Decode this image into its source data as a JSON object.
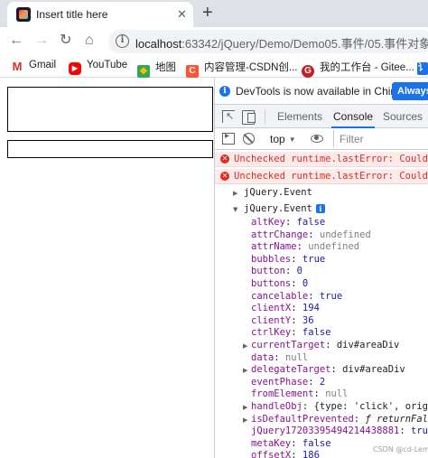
{
  "browser": {
    "tab_title": "Insert title here",
    "tab_close": "✕",
    "new_tab": "+",
    "nav": {
      "back": "←",
      "forward": "→",
      "reload": "↻",
      "home": "⌂"
    },
    "url_host": "localhost",
    "url_rest": ":63342/jQuery/Demo/Demo05.事件/05.事件对象",
    "info_glyph": "i"
  },
  "bookmarks": [
    {
      "label": "Gmail",
      "icon": "gmail-icon",
      "glyph": "M",
      "color": "#ffffff",
      "textcolor": "#d93025"
    },
    {
      "label": "YouTube",
      "icon": "youtube-icon",
      "glyph": "▶",
      "color": "#ff0000",
      "textcolor": "#ffffff"
    },
    {
      "label": "地图",
      "icon": "maps-icon",
      "glyph": "◆",
      "color": "#34a853",
      "textcolor": "#fbbc04"
    },
    {
      "label": "内容管理-CSDN创...",
      "icon": "csdn-icon",
      "glyph": "C",
      "color": "#fc5531",
      "textcolor": "#ffffff"
    },
    {
      "label": "我的工作台 - Gitee...",
      "icon": "gitee-icon",
      "glyph": "G",
      "color": "#c71d23",
      "textcolor": "#ffffff"
    },
    {
      "label": "讠",
      "icon": "extra-bookmark-icon",
      "glyph": "",
      "color": "#1a73e8",
      "textcolor": "#ffffff"
    }
  ],
  "devtools": {
    "info_text": "DevTools is now available in Chinese!",
    "info_glyph": "i",
    "always_label": "Always m",
    "tabs": [
      "Elements",
      "Console",
      "Sources"
    ],
    "active_tab": "Console",
    "context": "top",
    "filter_placeholder": "Filter",
    "errors": [
      "Unchecked runtime.lastError: Could not",
      "Unchecked runtime.lastError: Could not"
    ],
    "error_glyph": "✕",
    "collapsed_log": "jQuery.Event",
    "expanded_log": "jQuery.Event",
    "info_badge": "i",
    "properties": [
      {
        "key": "altKey",
        "value": "false",
        "type": "bool",
        "expandable": false
      },
      {
        "key": "attrChange",
        "value": "undefined",
        "type": "null",
        "expandable": false
      },
      {
        "key": "attrName",
        "value": "undefined",
        "type": "null",
        "expandable": false
      },
      {
        "key": "bubbles",
        "value": "true",
        "type": "bool",
        "expandable": false
      },
      {
        "key": "button",
        "value": "0",
        "type": "num",
        "expandable": false
      },
      {
        "key": "buttons",
        "value": "0",
        "type": "num",
        "expandable": false
      },
      {
        "key": "cancelable",
        "value": "true",
        "type": "bool",
        "expandable": false
      },
      {
        "key": "clientX",
        "value": "194",
        "type": "num",
        "expandable": false
      },
      {
        "key": "clientY",
        "value": "36",
        "type": "num",
        "expandable": false
      },
      {
        "key": "ctrlKey",
        "value": "false",
        "type": "bool",
        "expandable": false
      },
      {
        "key": "currentTarget",
        "value": "div#areaDiv",
        "type": "obj",
        "expandable": true
      },
      {
        "key": "data",
        "value": "null",
        "type": "null",
        "expandable": false
      },
      {
        "key": "delegateTarget",
        "value": "div#areaDiv",
        "type": "obj",
        "expandable": true
      },
      {
        "key": "eventPhase",
        "value": "2",
        "type": "num",
        "expandable": false
      },
      {
        "key": "fromElement",
        "value": "null",
        "type": "null",
        "expandable": false
      },
      {
        "key": "handleObj",
        "value": "{type: 'click', origType",
        "type": "obj",
        "expandable": true
      },
      {
        "key": "isDefaultPrevented",
        "value": "ƒ returnFalse()",
        "type": "fn",
        "expandable": true
      },
      {
        "key": "jQuery17203395494214438881",
        "value": "true",
        "type": "bool",
        "expandable": false
      },
      {
        "key": "metaKey",
        "value": "false",
        "type": "bool",
        "expandable": false
      },
      {
        "key": "offsetX",
        "value": "186",
        "type": "num",
        "expandable": false
      }
    ]
  },
  "watermark": "CSDN @cd-Lemon"
}
